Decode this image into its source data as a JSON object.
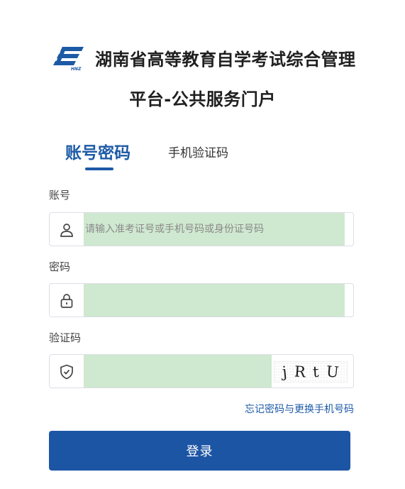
{
  "header": {
    "title_line1": "湖南省高等教育自学考试综合管理",
    "title_line2": "平台-公共服务门户",
    "logo_icon": "hnzk-logo-icon"
  },
  "tabs": [
    {
      "label": "账号密码",
      "active": true
    },
    {
      "label": "手机验证码",
      "active": false
    }
  ],
  "form": {
    "account": {
      "label": "账号",
      "placeholder": "请输入准考证号或手机号码或身份证号码",
      "value": "",
      "icon": "user-icon"
    },
    "password": {
      "label": "密码",
      "placeholder": "",
      "value": "",
      "icon": "lock-icon"
    },
    "captcha": {
      "label": "验证码",
      "placeholder": "",
      "value": "",
      "icon": "shield-check-icon",
      "image_text": [
        "j",
        "R",
        "t",
        "U"
      ]
    },
    "forgot_link": "忘记密码与更换手机号码",
    "login_button": "登录"
  },
  "colors": {
    "brand": "#1d5aa6",
    "button": "#1d55a5",
    "autofill": "#cfe8d0"
  }
}
